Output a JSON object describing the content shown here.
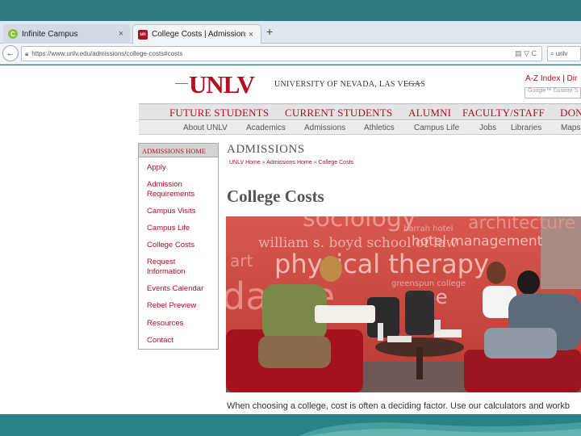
{
  "browser": {
    "tabs": [
      {
        "title": "Infinite Campus",
        "icon": "infinite-campus-favicon"
      },
      {
        "title": "College Costs | Admissions...",
        "icon": "unlv-favicon"
      }
    ],
    "close_glyph": "×",
    "new_tab_glyph": "+",
    "back_glyph": "←",
    "url": "https://www.unlv.edu/admissions/college-costs#costs",
    "search_text": "unlv"
  },
  "site": {
    "logo": "UNLV",
    "university_name": "UNIVERSITY OF NEVADA, LAS VEGAS",
    "az_index": "A-Z Index | Dir",
    "search_placeholder": "Google™ Custom S",
    "main_nav": [
      "FUTURE STUDENTS",
      "CURRENT STUDENTS",
      "ALUMNI",
      "FACULTY/STAFF",
      "DON"
    ],
    "sub_nav": [
      "About UNLV",
      "Academics",
      "Admissions",
      "Athletics",
      "Campus Life",
      "Jobs",
      "Libraries",
      "Maps"
    ]
  },
  "sidebar": {
    "heading": "ADMISSIONS HOME",
    "items": [
      [
        "Apply"
      ],
      [
        "Admission",
        "Requirements"
      ],
      [
        "Campus Visits"
      ],
      [
        "Campus Life"
      ],
      [
        "College Costs"
      ],
      [
        "Request",
        "Information"
      ],
      [
        "Events Calendar"
      ],
      [
        "Rebel Preview"
      ],
      [
        "Resources"
      ],
      [
        "Contact"
      ]
    ]
  },
  "content": {
    "section_title": "ADMISSIONS",
    "breadcrumb": [
      "UNLV Home",
      "Admissions Home",
      "College Costs"
    ],
    "breadcrumb_sep": "»",
    "page_title": "College Costs",
    "photo_words": [
      "sociology",
      "architecture",
      "harrah hotel",
      "william s. boyd school of law",
      "hotel management",
      "art",
      "physical therapy",
      "greenspun college",
      "dance",
      "spe"
    ],
    "intro": "When choosing a college, cost is often a deciding factor. Use our calculators and workb"
  },
  "colors": {
    "unlv_red": "#b10f22",
    "slide_teal": "#2a7c80"
  }
}
